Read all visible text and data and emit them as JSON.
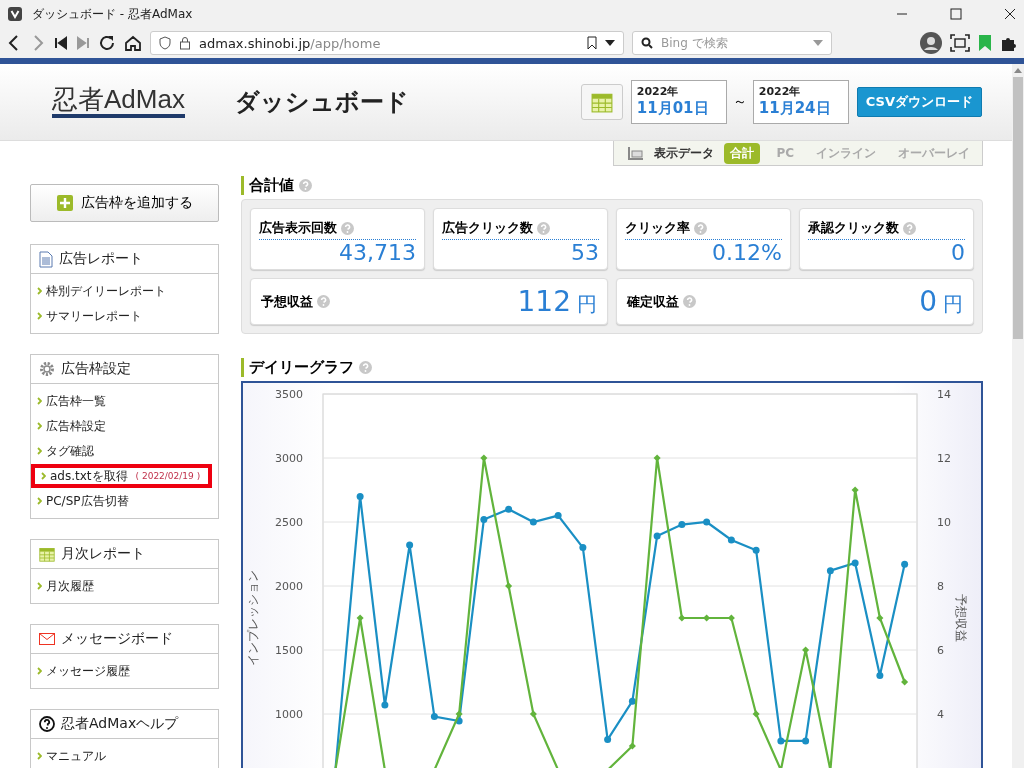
{
  "browser": {
    "tab_title": "ダッシュボード - 忍者AdMax",
    "url_host": "admax.shinobi.jp",
    "url_path": "/app/home",
    "search_placeholder": "Bing で検索"
  },
  "header": {
    "logo": "忍者AdMax",
    "title": "ダッシュボード",
    "date_from": {
      "year": "2022年",
      "day": "11月01日"
    },
    "separator": "～",
    "date_to": {
      "year": "2022年",
      "day": "11月24日"
    },
    "csv_button": "CSVダウンロード"
  },
  "display_tabs": {
    "label": "表示データ",
    "tabs": [
      {
        "label": "合計",
        "selected": true
      },
      {
        "label": "PC",
        "selected": false
      },
      {
        "label": "インライン",
        "selected": false
      },
      {
        "label": "オーバーレイ",
        "selected": false
      }
    ]
  },
  "sidebar": {
    "add_button": "広告枠を追加する",
    "sections": [
      {
        "kind": "report",
        "title": "広告レポート",
        "items": [
          {
            "label": "枠別デイリーレポート",
            "highlighted": false
          },
          {
            "label": "サマリーレポート",
            "highlighted": false
          }
        ]
      },
      {
        "kind": "settings",
        "title": "広告枠設定",
        "items": [
          {
            "label": "広告枠一覧",
            "highlighted": false
          },
          {
            "label": "広告枠設定",
            "highlighted": false
          },
          {
            "label": "タグ確認",
            "highlighted": false
          },
          {
            "label": "ads.txtを取得",
            "note": "( 2022/02/19 )",
            "highlighted": true
          },
          {
            "label": "PC/SP広告切替",
            "highlighted": false
          }
        ]
      },
      {
        "kind": "calendar",
        "title": "月次レポート",
        "items": [
          {
            "label": "月次履歴",
            "highlighted": false
          }
        ]
      },
      {
        "kind": "mail",
        "title": "メッセージボード",
        "items": [
          {
            "label": "メッセージ履歴",
            "highlighted": false
          }
        ]
      },
      {
        "kind": "help",
        "title": "忍者AdMaxヘルプ",
        "items": [
          {
            "label": "マニュアル",
            "highlighted": false
          }
        ]
      }
    ]
  },
  "totals": {
    "title": "合計値",
    "stats": [
      {
        "label": "広告表示回数",
        "value": "43,713"
      },
      {
        "label": "広告クリック数",
        "value": "53"
      },
      {
        "label": "クリック率",
        "value": "0.12%"
      },
      {
        "label": "承認クリック数",
        "value": "0"
      }
    ],
    "earnings": [
      {
        "label": "予想収益",
        "value": "112",
        "unit": "円"
      },
      {
        "label": "確定収益",
        "value": "0",
        "unit": "円"
      }
    ]
  },
  "daily_graph": {
    "title": "デイリーグラフ",
    "chart_data": {
      "type": "line",
      "ylabel": "インプレッション",
      "y2label": "予想収益",
      "grid": true,
      "ylim": [
        562.5,
        3500
      ],
      "yticks": [
        1000,
        1500,
        2000,
        2500,
        3000,
        3500
      ],
      "y2lim": [
        2.25,
        14
      ],
      "y2ticks": [
        4,
        6,
        8,
        10,
        12,
        14
      ],
      "series": [
        {
          "color": "#1a8fc4",
          "axis": "y",
          "marker": "circle",
          "values": [
            562.5,
            2700,
            1070,
            2320,
            980,
            945,
            2520,
            2600,
            2500,
            2550,
            2300,
            800,
            1100,
            2390,
            2480,
            2500,
            2360,
            2280,
            790,
            790,
            2120,
            2180,
            1300,
            2170
          ]
        },
        {
          "color": "#62b43c",
          "axis": "y2",
          "marker": "diamond",
          "values": [
            2.25,
            7,
            2.25,
            null,
            2.25,
            4,
            12,
            8,
            4,
            2.25,
            null,
            2.25,
            3,
            12,
            7,
            7,
            7,
            4,
            2.25,
            6,
            2.25,
            11,
            7,
            5
          ]
        }
      ]
    }
  }
}
